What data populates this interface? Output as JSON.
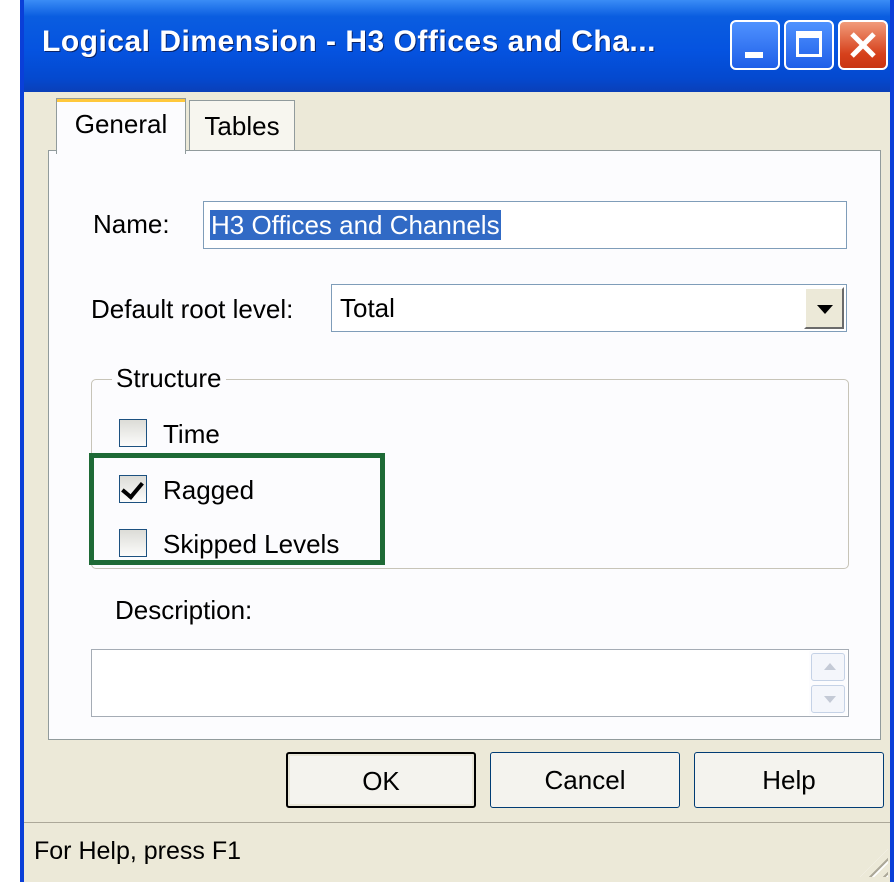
{
  "window": {
    "title": "Logical Dimension - H3 Offices and Cha..."
  },
  "tabs": [
    {
      "label": "General",
      "active": true
    },
    {
      "label": "Tables",
      "active": false
    }
  ],
  "general": {
    "name_label": "Name:",
    "name_value": "H3 Offices and Channels",
    "root_label": "Default root level:",
    "root_value": "Total",
    "structure": {
      "legend": "Structure",
      "options": [
        {
          "label": "Time",
          "checked": false
        },
        {
          "label": "Ragged",
          "checked": true
        },
        {
          "label": "Skipped Levels",
          "checked": false
        }
      ]
    },
    "description_label": "Description:",
    "description_value": ""
  },
  "buttons": {
    "ok": "OK",
    "cancel": "Cancel",
    "help": "Help"
  },
  "status": {
    "text": "For Help, press F1"
  },
  "colors": {
    "titlebar": "#0553e0",
    "dialog_bg": "#ece9d8",
    "selection": "#316ac5",
    "highlight_box": "#1e6a36"
  }
}
